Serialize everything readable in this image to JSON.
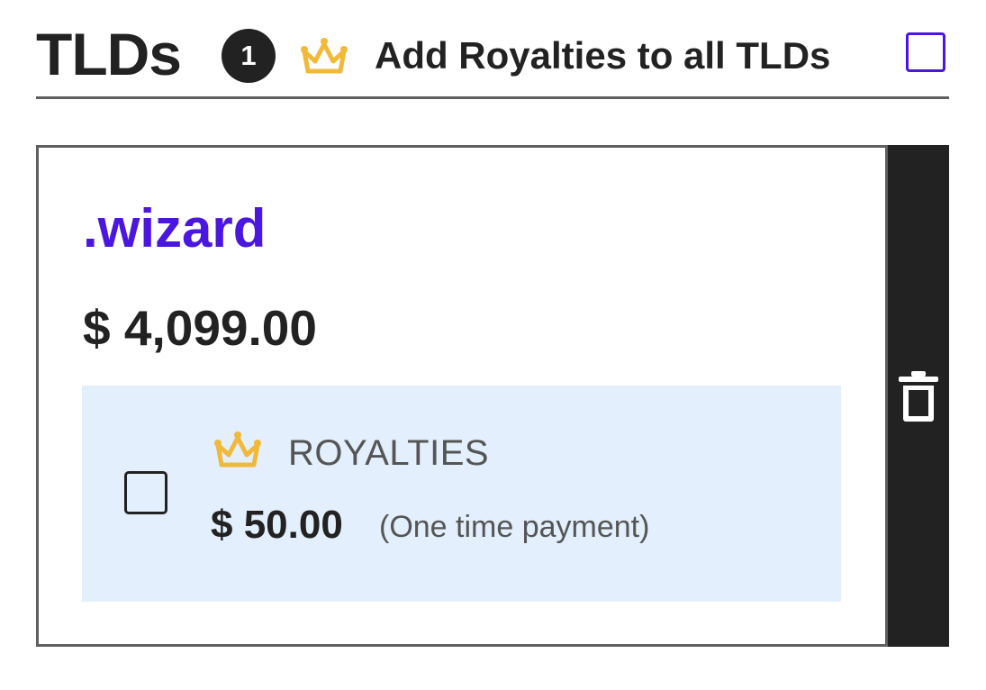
{
  "header": {
    "title": "TLDs",
    "count": "1",
    "add_royalties_label": "Add Royalties to all TLDs",
    "add_royalties_checked": false,
    "crown_icon": "crown-icon"
  },
  "tld_card": {
    "name": ".wizard",
    "price": "$ 4,099.00",
    "royalties": {
      "label": "ROYALTIES",
      "price": "$ 50.00",
      "note": "(One time payment)",
      "checked": false,
      "crown_icon": "crown-icon"
    },
    "delete_icon": "trash-icon"
  },
  "colors": {
    "accent": "#4a16e0",
    "crown": "#f0b93a",
    "royalty_background": "#e3effc",
    "dark": "#222222"
  }
}
